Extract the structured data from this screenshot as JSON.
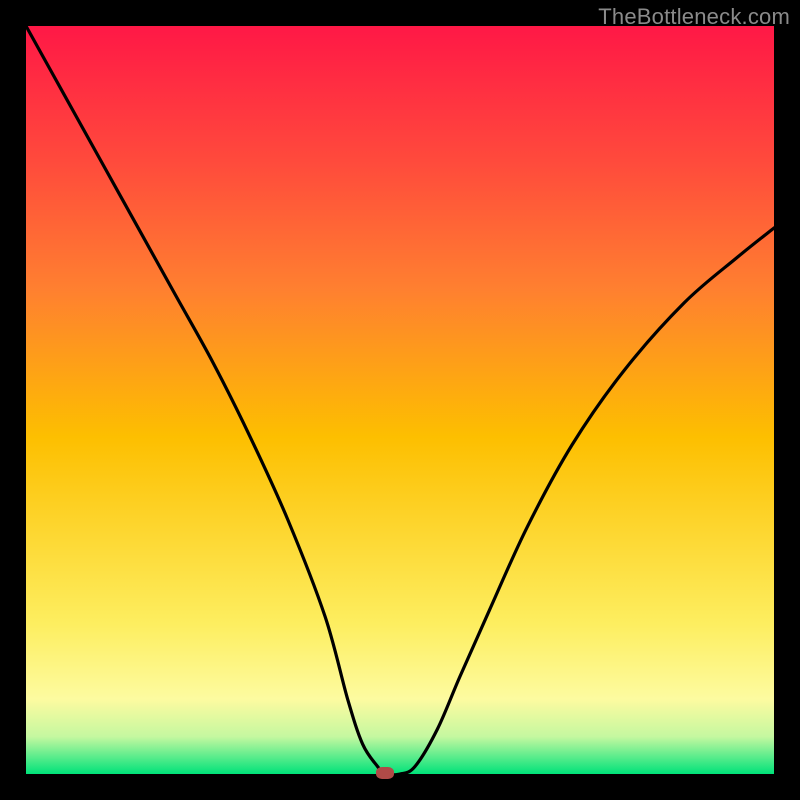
{
  "watermark": "TheBottleneck.com",
  "colors": {
    "frame": "#000000",
    "gradient_top": "#ff1846",
    "gradient_mid1": "#fdbf00",
    "gradient_mid2": "#fdfba0",
    "gradient_bottom": "#00e27a",
    "curve": "#000000",
    "marker": "#b04a47"
  },
  "chart_data": {
    "type": "line",
    "title": "",
    "xlabel": "",
    "ylabel": "",
    "x_range": [
      0,
      100
    ],
    "y_range": [
      0,
      100
    ],
    "annotations": [],
    "legend": null,
    "grid": false,
    "series": [
      {
        "name": "curve",
        "x": [
          0,
          5,
          10,
          15,
          20,
          25,
          30,
          35,
          40,
          43,
          45,
          47,
          48,
          50,
          52,
          55,
          58,
          62,
          67,
          73,
          80,
          88,
          95,
          100
        ],
        "y": [
          100,
          91,
          82,
          73,
          64,
          55,
          45,
          34,
          21,
          10,
          4,
          1,
          0,
          0,
          1,
          6,
          13,
          22,
          33,
          44,
          54,
          63,
          69,
          73
        ]
      }
    ],
    "marker": {
      "x": 48,
      "y": 0
    }
  }
}
